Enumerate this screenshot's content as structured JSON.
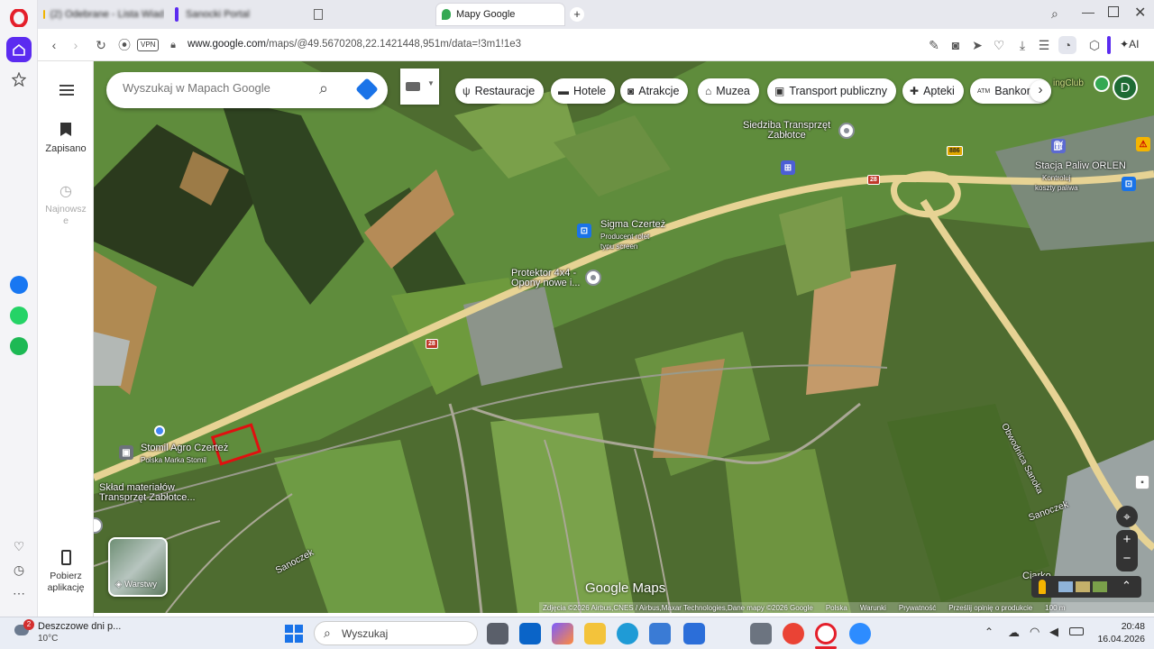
{
  "tabs": [
    {
      "label": "(2) Odebrane - Lista Wiad",
      "icon": "mail-icon"
    },
    {
      "label": "Sanocki Portal",
      "icon": "news-icon"
    },
    {
      "label": "",
      "icon": "document-icon"
    },
    {
      "label": "Mapy Google",
      "icon": "maps-icon"
    }
  ],
  "address": {
    "vpn": "VPN",
    "url_host": "www.google.com",
    "url_path": "/maps/@49.5670208,22.1421448,951m/data=!3m1!1e3"
  },
  "ai_label": "AI",
  "maps_sidebar": {
    "saved": "Zapisano",
    "recent": "Najnowsze",
    "get_app": "Pobierz aplikację"
  },
  "search": {
    "placeholder": "Wyszukaj w Mapach Google"
  },
  "categories": [
    "Restauracje",
    "Hotele",
    "Atrakcje",
    "Muzea",
    "Transport publiczny",
    "Apteki",
    "Bankomaty"
  ],
  "user_initial": "D",
  "places": {
    "siedziba": "Siedziba Transprzęt\nZabłotce",
    "orlen": "Stacja Paliw ORLEN",
    "orlen_sub": "Kontroluj\nkoszty paliwa",
    "sigma": "Sigma Czerteż",
    "sigma_sub": "Producent rolet\ntypu screen",
    "protektor": "Protektor 4x4 -\nOpony nowe i...",
    "stomil": "Stomil Agro Czerteż",
    "stomil_sub": "Polska Marka Stomil",
    "sklad": "Skład materiałów\nTransprzęt Zabłotce...",
    "obwodnica": "Obwodnica Sanoka",
    "sanoczek1": "Sanoczek",
    "sanoczek2": "Sanoczek",
    "ciarko": "Ciarko",
    "bowling": "ingClub"
  },
  "road_numbers": [
    "28",
    "28",
    "28",
    "886"
  ],
  "layers_label": "Warstwy",
  "logo": "Google Maps",
  "attribution": [
    "Zdjęcia ©2026 Airbus,CNES / Airbus,Maxar Technologies,Dane mapy ©2026 Google",
    "Polska",
    "Warunki",
    "Prywatność",
    "Prześlij opinię o produkcie",
    "100 m"
  ],
  "taskbar": {
    "weather_title": "Deszczowe dni p...",
    "weather_temp": "10°C",
    "weather_badge": "2",
    "search_label": "Wyszukaj",
    "time": "20:48",
    "date": "16.04.2026"
  },
  "colors": {
    "opera_red": "#e41f2b",
    "maps_blue": "#1a73e8",
    "highlight_red": "#e01010",
    "avatar_green": "#1e6b34"
  }
}
